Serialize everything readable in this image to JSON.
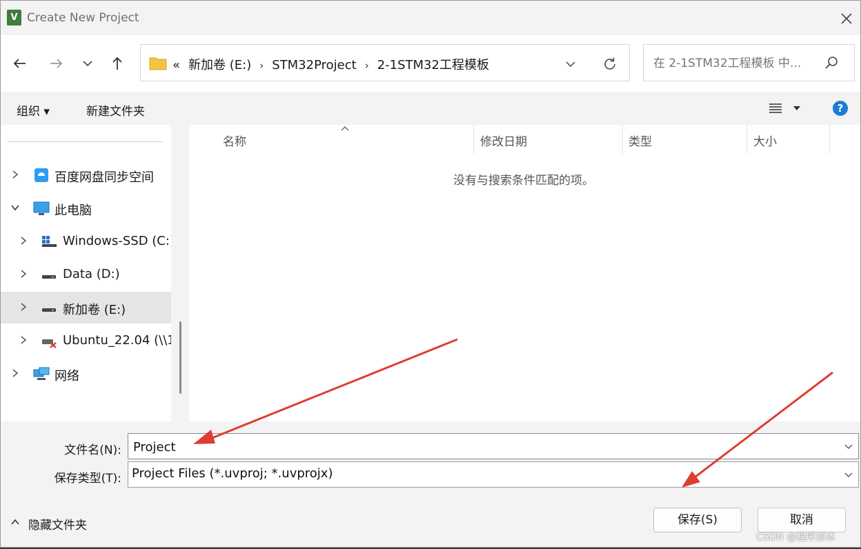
{
  "window": {
    "title": "Create New Project",
    "app_icon_letter": "V"
  },
  "nav": {
    "breadcrumb": [
      "«",
      "新加卷 (E:)",
      "STM32Project",
      "2-1STM32工程模板"
    ],
    "search_placeholder": "在 2-1STM32工程模板 中..."
  },
  "toolbar": {
    "organize_label": "组织 ▾",
    "new_folder_label": "新建文件夹"
  },
  "sidebar": {
    "items": [
      {
        "label": "百度网盘同步空间",
        "icon": "baidu-netdisk-icon",
        "expanded": false
      },
      {
        "label": "此电脑",
        "icon": "this-pc-icon",
        "expanded": true
      },
      {
        "label": "Windows-SSD (C:)",
        "icon": "windows-drive-icon",
        "expanded": false
      },
      {
        "label": "Data (D:)",
        "icon": "drive-icon",
        "expanded": false
      },
      {
        "label": "新加卷 (E:)",
        "icon": "drive-icon",
        "expanded": false,
        "selected": true
      },
      {
        "label": "Ubuntu_22.04 (\\\\1",
        "icon": "network-drive-disconnected-icon",
        "expanded": false
      },
      {
        "label": "网络",
        "icon": "network-icon",
        "expanded": false
      }
    ]
  },
  "file_list": {
    "columns": [
      "名称",
      "修改日期",
      "类型",
      "大小"
    ],
    "empty_message": "没有与搜索条件匹配的项。"
  },
  "form": {
    "filename_label": "文件名(N):",
    "filename_value": "Project",
    "filetype_label": "保存类型(T):",
    "filetype_value": "Project Files (*.uvproj; *.uvprojx)"
  },
  "footer": {
    "hide_folders_label": "隐藏文件夹",
    "save_label": "保存(S)",
    "cancel_label": "取消"
  },
  "watermark": "CSDN @程序加冰",
  "colors": {
    "annotation_arrow": "#e03c31",
    "help_icon": "#1e7bd6",
    "folder": "#f5c242"
  }
}
